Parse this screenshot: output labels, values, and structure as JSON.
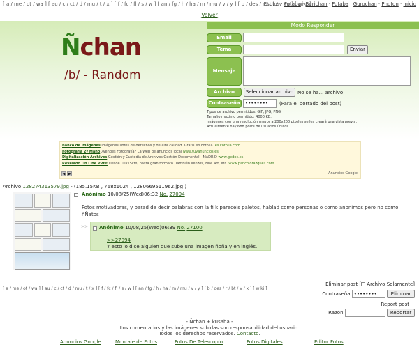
{
  "topnav": {
    "boards": "[ a / me / ot / wa ] [ au / c / ct / d / mu / t / x ] [ f / fc / fl / s / w ] [ an / fg / h / ha / m / mu / v / y ] [ b / des / r / bt / v / x ] [ wiki ]",
    "links": [
      "Estilos",
      "Fotaba",
      "Burichan",
      "Futaba",
      "Gurochan",
      "Photon"
    ],
    "inicio": "Inicio"
  },
  "volver": "Volver",
  "header": {
    "mode": "Modo Responder",
    "logo_n": "Ñ",
    "logo_rest": "chan",
    "board_title": "/b/ - Random"
  },
  "form": {
    "email_label": "Email",
    "tema_label": "Tema",
    "enviar": "Enviar",
    "mensaje_label": "Mensaje",
    "archivo_label": "Archivo",
    "select_file": "Seleccionar archivo",
    "no_file": "No se ha... archivo",
    "password_label": "Contraseña",
    "password_value": "••••••••",
    "password_note": "(Para el borrado del post)",
    "rules": [
      "Tipos de archivo permitidos: GIF, JPG, PNG",
      "Tamaño máximo permitido: 4000 KB.",
      "Imágenes con una resolución mayor a 200x200 pixeles se les creará una vista previa.",
      "Actualmente hay 688 posts de usuarios únicos."
    ]
  },
  "ads": {
    "items": [
      {
        "title": "Banco de imágenes",
        "desc": "Imágenes libres de derechos y de alta calidad. Gratis en Fotolia.",
        "url": "es.Fotolia.com"
      },
      {
        "title": "Fotografía 2ª Mano",
        "desc": "¿Vendes Fotografía? La Web de anuncios local",
        "url": "www.tuyanuncios.es"
      },
      {
        "title": "Digitalización Archivos",
        "desc": "Gestión y Custodia de Archivos Gestión Documental - MADRID",
        "url": "www.gedoc.es"
      },
      {
        "title": "Revelado On Line PVEF",
        "desc": "Desde 10x15cm, hasta gran formato. También lienzos, Fine Art, etc.",
        "url": "www.pancolorazquez.com"
      }
    ],
    "google_label": "Anuncios Google"
  },
  "thread": {
    "file_prefix": "Archivo",
    "file_name": "128274313579.jpg",
    "file_meta": "- (185.15KB , 768x1024 , 1280669511962.jpg )",
    "op": {
      "name": "Anónimo",
      "date": "10/08/25(Wed)06:32",
      "no_label": "No.",
      "no": "27094",
      "message": "Fotos motivadoras, y parad de decir palabras con la fi k pareceis paletos, hablad como personas o como anonimos pero no como ñÑatos"
    },
    "reply": {
      "dots": ">>",
      "name": "Anónimo",
      "date": "10/08/25(Wed)06:39",
      "no_label": "No.",
      "no": "27100",
      "quote": ">>27094",
      "message": "Y esto lo dice alguien que sube una imagen ñoña y en inglés."
    }
  },
  "bottom": {
    "boards": "[ a / me / ot / wa ] [ au / c / ct / d / mu / t / x ] [ f / fc / fl / s / w ] [ an / fg / h / ha / m / mu / v / y ] [ b / des / r / bt / v / x ] [ wiki ]",
    "delete_post": "Eliminar post",
    "file_only": "Archivo Solamente",
    "password_label": "Contraseña",
    "password_value": "••••••••",
    "delete_btn": "Eliminar",
    "report_title": "Report post",
    "reason_label": "Razón",
    "report_btn": "Reportar"
  },
  "footer": {
    "line1": "- Ñchan + kusaba -",
    "line2": "Los comentarios y las imágenes subidas son responsabilidad del usuario.",
    "line3_pre": "Todos los derechos reservados.",
    "line3_link": "Contacto",
    "links": [
      "Anuncios Google",
      "Montaje de Fotos",
      "Fotos De Telescopio",
      "Fotos Digitales",
      "Editor Fotos"
    ]
  },
  "colors": {
    "accent_green": "#8cc050",
    "logo_green": "#2e7d1a",
    "logo_red": "#7a1818",
    "reply_bg": "#d7ebc0"
  }
}
